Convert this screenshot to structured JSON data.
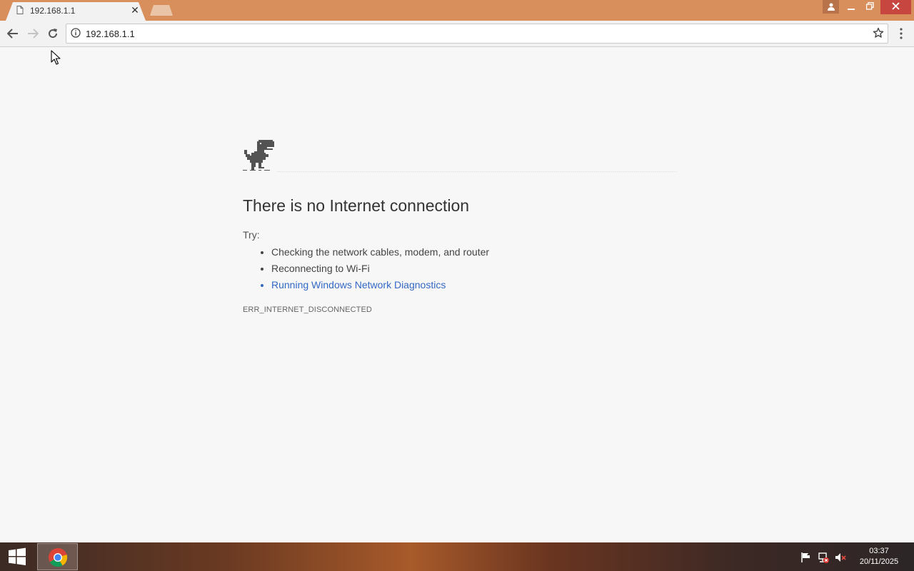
{
  "browser": {
    "tab": {
      "title": "192.168.1.1"
    },
    "omnibox": {
      "url": "192.168.1.1"
    }
  },
  "page": {
    "heading": "There is no Internet connection",
    "try_label": "Try:",
    "suggestions": [
      "Checking the network cables, modem, and router",
      "Reconnecting to Wi-Fi",
      "Running Windows Network Diagnostics"
    ],
    "error_code": "ERR_INTERNET_DISCONNECTED"
  },
  "taskbar": {
    "clock": {
      "time": "03:37",
      "date": "20/11/2025"
    }
  },
  "colors": {
    "titlebar": "#d98f5c",
    "close_button": "#c7463f",
    "link": "#3368c4",
    "page_background": "#f7f7f7"
  },
  "icons": {
    "tab": "file-icon",
    "tab_close": "close-icon",
    "nav": [
      "back-arrow-icon",
      "forward-arrow-icon",
      "reload-icon"
    ],
    "omnibox": [
      "info-icon",
      "star-icon"
    ],
    "menu": "kebab-menu-icon",
    "page": "dino-icon",
    "tray": [
      "action-center-flag-icon",
      "network-disconnected-icon",
      "speaker-muted-icon"
    ]
  }
}
